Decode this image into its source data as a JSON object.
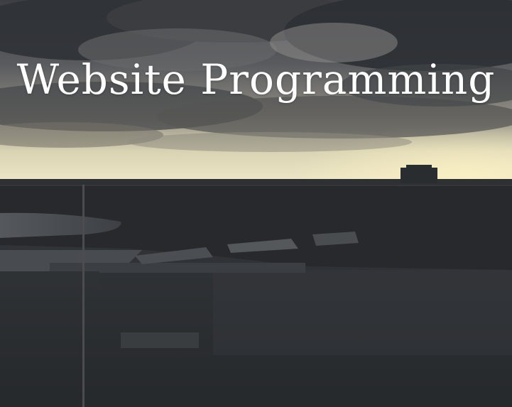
{
  "hero": {
    "title": "Website Programming"
  },
  "colors": {
    "title_text": "#ffffff",
    "sky_dark": "#3a3d42",
    "sky_glow": "#e9e3c6",
    "water": "#2a2d31",
    "land_silhouette": "#25282b"
  },
  "scene": {
    "description_tag": "cloudy-harbor-sunset-photo"
  }
}
